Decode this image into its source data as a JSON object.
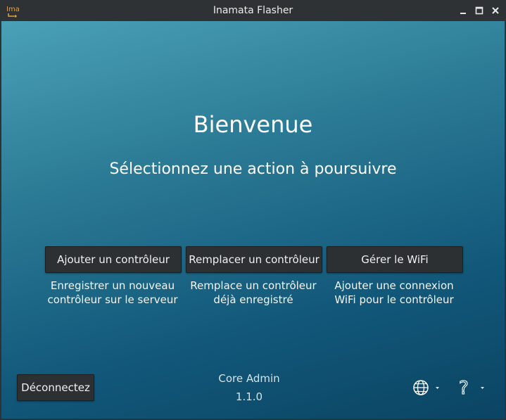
{
  "window": {
    "title": "Inamata Flasher",
    "app_icon_text": "Ima"
  },
  "welcome": {
    "heading": "Bienvenue",
    "subheading": "Sélectionnez une action à poursuivre"
  },
  "actions": [
    {
      "label": "Ajouter un contrôleur",
      "description": "Enregistrer un nouveau\ncontrôleur sur le serveur"
    },
    {
      "label": "Remplacer un contrôleur",
      "description": "Remplace un contrôleur\ndéjà enregistré"
    },
    {
      "label": "Gérer le WiFi",
      "description": "Ajouter une connexion\nWiFi pour le contrôleur"
    }
  ],
  "footer": {
    "logout_label": "Déconnectez",
    "role": "Core Admin",
    "version": "1.1.0",
    "language_icon": "globe-icon",
    "help_icon": "question-mark-icon"
  },
  "colors": {
    "gradient_top": "#4aa1b6",
    "gradient_bottom": "#0b4463",
    "button_bg": "#2d3033",
    "titlebar_bg": "#2f3234",
    "icon_accent": "#e8a238"
  }
}
